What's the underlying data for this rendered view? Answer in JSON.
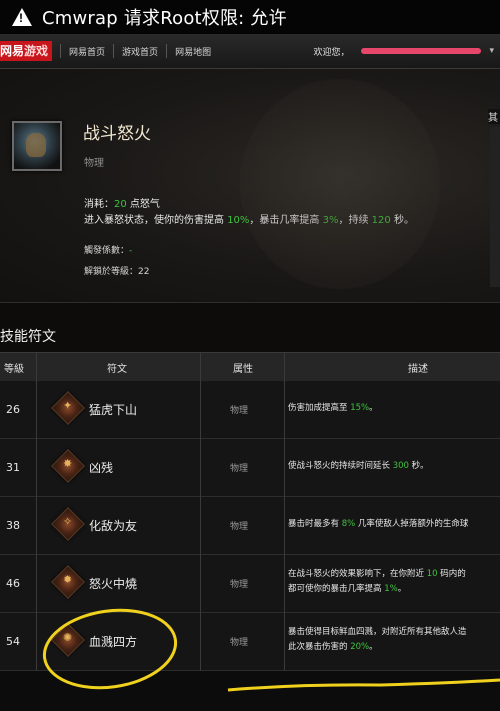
{
  "status_bar": {
    "warning_glyph": "!",
    "text": "Cmwrap 请求Root权限: 允许"
  },
  "site_nav": {
    "logo": {
      "part1": "网易",
      "part2": "游戏"
    },
    "links": [
      "网易首页",
      "游戏首页",
      "网易地图"
    ],
    "welcome": "欢迎您，",
    "caret": "▾"
  },
  "skill": {
    "title": "战斗怒火",
    "type": "物理",
    "cost_label": "消耗：",
    "cost_value": "20",
    "cost_unit": "点怒气",
    "desc_parts": [
      "进入暴怒状态，使你的伤害提高 ",
      "10%",
      "，暴击几率提高 ",
      "3%",
      "，持续 ",
      "120",
      " 秒。"
    ],
    "coef_label": "觸發係數：",
    "coef_value": "-",
    "unlock_label": "解鎖於等級：",
    "unlock_value": "22",
    "edge_label": "其"
  },
  "runes_section": {
    "title": "技能符文",
    "headers": {
      "level": "等級",
      "rune": "符文",
      "attr": "属性",
      "desc": "描述"
    },
    "rows": [
      {
        "level": "26",
        "glyph": "✦",
        "name": "猛虎下山",
        "attr": "物理",
        "desc_parts": [
          "伤害加成提高至 ",
          "15%",
          "。"
        ]
      },
      {
        "level": "31",
        "glyph": "✸",
        "name": "凶残",
        "attr": "物理",
        "desc_parts": [
          "使战斗怒火的持续时间延长 ",
          "300",
          " 秒。"
        ]
      },
      {
        "level": "38",
        "glyph": "✧",
        "name": "化敌为友",
        "attr": "物理",
        "desc_parts": [
          "暴击时最多有 ",
          "8%",
          " 几率使敌人掉落额外的生命球"
        ]
      },
      {
        "level": "46",
        "glyph": "✹",
        "name": "怒火中燒",
        "attr": "物理",
        "desc_line1_parts": [
          "在战斗怒火的效果影响下，在你附近 ",
          "10",
          " 码内的"
        ],
        "desc_line2_parts": [
          "都可使你的暴击几率提高 ",
          "1%",
          "。"
        ]
      },
      {
        "level": "54",
        "glyph": "✺",
        "name": "血溅四方",
        "attr": "物理",
        "desc_line1_parts": [
          "暴击使得目标鲜血四溅，对附近所有其他敌人造"
        ],
        "desc_line2_parts": [
          "此次暴击伤害的 ",
          "20%",
          "。"
        ]
      }
    ]
  },
  "colors": {
    "highlight_green": "#3fc33f",
    "annotation_yellow": "#f0d21e",
    "username_scribble": "#e8476c",
    "logo_red": "#c8151b"
  }
}
